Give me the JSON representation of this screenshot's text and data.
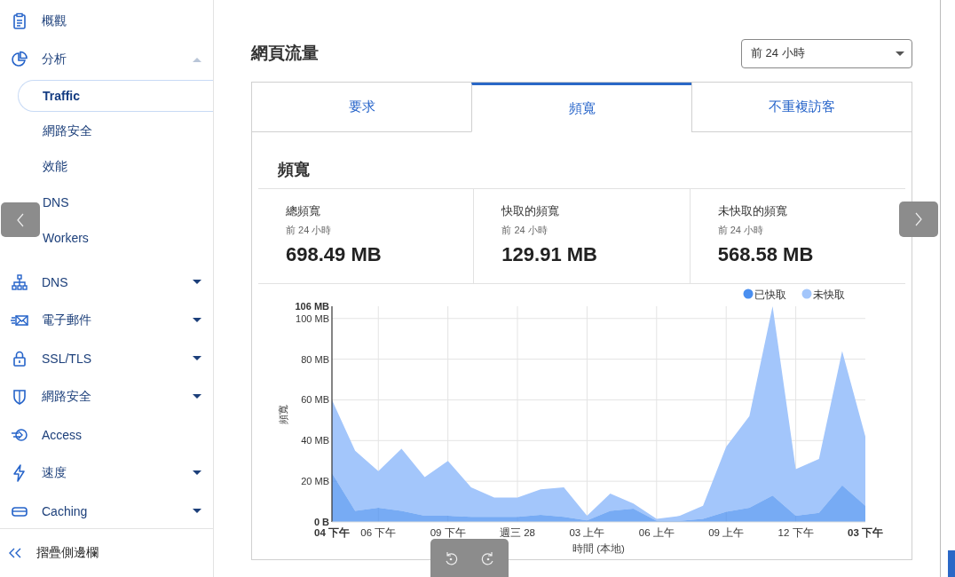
{
  "sidebar": {
    "items": [
      {
        "label": "概觀"
      },
      {
        "label": "分析",
        "expanded": true,
        "children": [
          {
            "label": "Traffic",
            "selected": true
          },
          {
            "label": "網路安全",
            "selected": false
          },
          {
            "label": "效能",
            "selected": false
          },
          {
            "label": "DNS",
            "selected": false
          },
          {
            "label": "Workers",
            "selected": false
          }
        ]
      },
      {
        "label": "DNS",
        "expanded": false
      },
      {
        "label": "電子郵件",
        "expanded": false
      },
      {
        "label": "SSL/TLS",
        "expanded": false
      },
      {
        "label": "網路安全",
        "expanded": false
      },
      {
        "label": "Access"
      },
      {
        "label": "速度",
        "expanded": false
      },
      {
        "label": "Caching",
        "expanded": false
      }
    ],
    "collapse": "摺疊側邊欄"
  },
  "page": {
    "title": "網頁流量",
    "range_select": {
      "value": "前 24 小時"
    }
  },
  "tabs": [
    {
      "label": "要求",
      "selected": false
    },
    {
      "label": "頻寬",
      "selected": true
    },
    {
      "label": "不重複訪客",
      "selected": false
    }
  ],
  "panel": {
    "heading": "頻寬",
    "stats": [
      {
        "label": "總頻寬",
        "period": "前 24 小時",
        "value": "698.49 MB"
      },
      {
        "label": "快取的頻寬",
        "period": "前 24 小時",
        "value": "129.91 MB"
      },
      {
        "label": "未快取的頻寬",
        "period": "前 24 小時",
        "value": "568.58 MB"
      }
    ],
    "chart_data": {
      "type": "area",
      "stacked": true,
      "xlabel": "時間 (本地)",
      "ylabel": "頻寬",
      "categories": [
        "04 下午",
        null,
        "06 下午",
        null,
        null,
        "09 下午",
        null,
        null,
        "週三 28",
        null,
        null,
        "03 上午",
        null,
        null,
        "06 上午",
        null,
        null,
        "09 上午",
        null,
        null,
        "12 下午",
        null,
        null,
        "03 下午"
      ],
      "series": [
        {
          "name": "已快取",
          "color": "#4a8ff0",
          "values": [
            24,
            5.5,
            7,
            5.5,
            3,
            3,
            2.5,
            2.5,
            2.5,
            3.5,
            2.5,
            0.8,
            5.5,
            6.5,
            0.5,
            0.5,
            1.5,
            5,
            7,
            13,
            3,
            4.5,
            18,
            8
          ]
        },
        {
          "name": "未快取",
          "color": "#a3c6fb",
          "values": [
            36,
            29.5,
            18,
            30.5,
            19,
            27,
            14.5,
            9.5,
            9.5,
            12.5,
            14.5,
            2.2,
            8.5,
            2.5,
            1,
            2.5,
            6.5,
            32,
            45,
            93,
            23,
            26.5,
            66,
            34
          ]
        }
      ],
      "ylim": [
        0,
        106
      ],
      "grid": true,
      "legend": "top-right",
      "yticks": [
        {
          "value": 0,
          "label": "0 B"
        },
        {
          "value": 20,
          "label": "20 MB"
        },
        {
          "value": 40,
          "label": "40 MB"
        },
        {
          "value": 60,
          "label": "60 MB"
        },
        {
          "value": 80,
          "label": "80 MB"
        },
        {
          "value": 100,
          "label": "100 MB"
        },
        {
          "value": 106,
          "label": "106 MB"
        }
      ]
    }
  }
}
